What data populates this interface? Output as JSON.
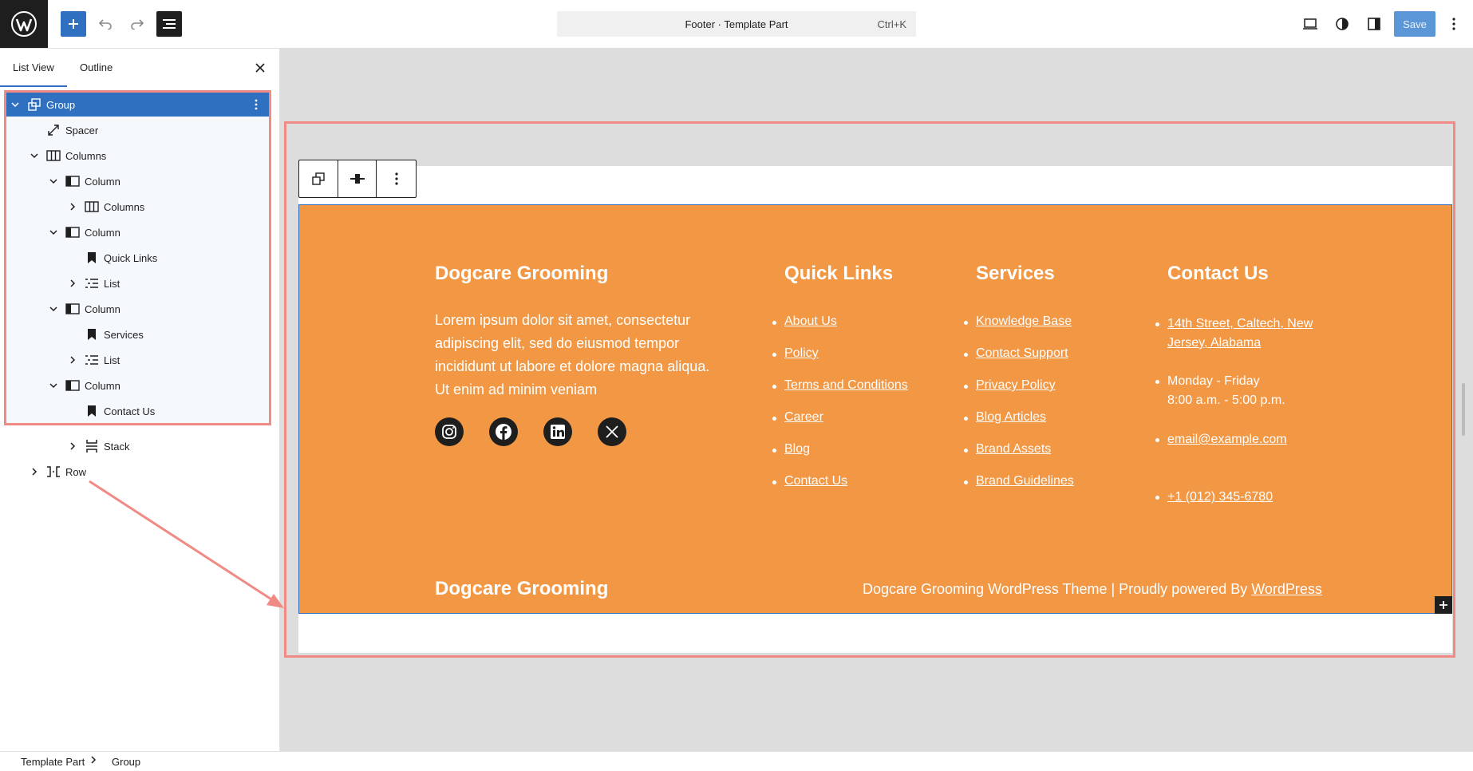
{
  "header": {
    "command_title": "Footer · Template Part",
    "command_shortcut": "Ctrl+K",
    "save_label": "Save"
  },
  "sidebar": {
    "tabs": [
      {
        "label": "List View",
        "active": true
      },
      {
        "label": "Outline",
        "active": false
      }
    ],
    "tree": [
      {
        "label": "Group",
        "icon": "group-icon",
        "selected": true
      },
      {
        "label": "Spacer",
        "icon": "spacer-icon"
      },
      {
        "label": "Columns",
        "icon": "columns-icon"
      },
      {
        "label": "Column",
        "icon": "column-icon"
      },
      {
        "label": "Columns",
        "icon": "columns-icon"
      },
      {
        "label": "Column",
        "icon": "column-icon"
      },
      {
        "label": "Quick Links",
        "icon": "bookmark-icon"
      },
      {
        "label": "List",
        "icon": "list-icon"
      },
      {
        "label": "Column",
        "icon": "column-icon"
      },
      {
        "label": "Services",
        "icon": "bookmark-icon"
      },
      {
        "label": "List",
        "icon": "list-icon"
      },
      {
        "label": "Column",
        "icon": "column-icon"
      },
      {
        "label": "Contact Us",
        "icon": "bookmark-icon"
      },
      {
        "label": "Stack",
        "icon": "stack-icon"
      },
      {
        "label": "Row",
        "icon": "row-icon"
      }
    ]
  },
  "breadcrumb": {
    "items": [
      "Template Part",
      "Group"
    ]
  },
  "footer": {
    "brand": "Dogcare Grooming",
    "description": "Lorem ipsum dolor sit amet, consectetur adipiscing elit, sed do eiusmod tempor incididunt ut labore et dolore magna aliqua. Ut enim ad minim veniam",
    "social": [
      "instagram-icon",
      "facebook-icon",
      "linkedin-icon",
      "x-icon"
    ],
    "quick_links": {
      "title": "Quick Links",
      "items": [
        "About Us",
        "Policy",
        "Terms and Conditions",
        "Career",
        "Blog",
        "Contact Us"
      ]
    },
    "services": {
      "title": "Services",
      "items": [
        "Knowledge Base",
        "Contact Support",
        "Privacy Policy",
        "Blog Articles",
        "Brand Assets",
        "Brand Guidelines"
      ]
    },
    "contact": {
      "title": "Contact Us",
      "address_line1": "14th Street, Caltech, New ",
      "address_line2": "Jersey, Alabama",
      "hours_line1": "Monday - Friday",
      "hours_line2": "8:00 a.m. - 5:00 p.m.",
      "email": "email@example.com",
      "phone": "+1 (012) 345-6780"
    },
    "bottom_brand": "Dogcare Grooming",
    "credit_text": "Dogcare Grooming WordPress Theme | Proudly powered By ",
    "credit_link": "WordPress"
  },
  "colors": {
    "footer_bg": "#f29744",
    "accent": "#2f70c1",
    "highlight": "#f08a84"
  }
}
